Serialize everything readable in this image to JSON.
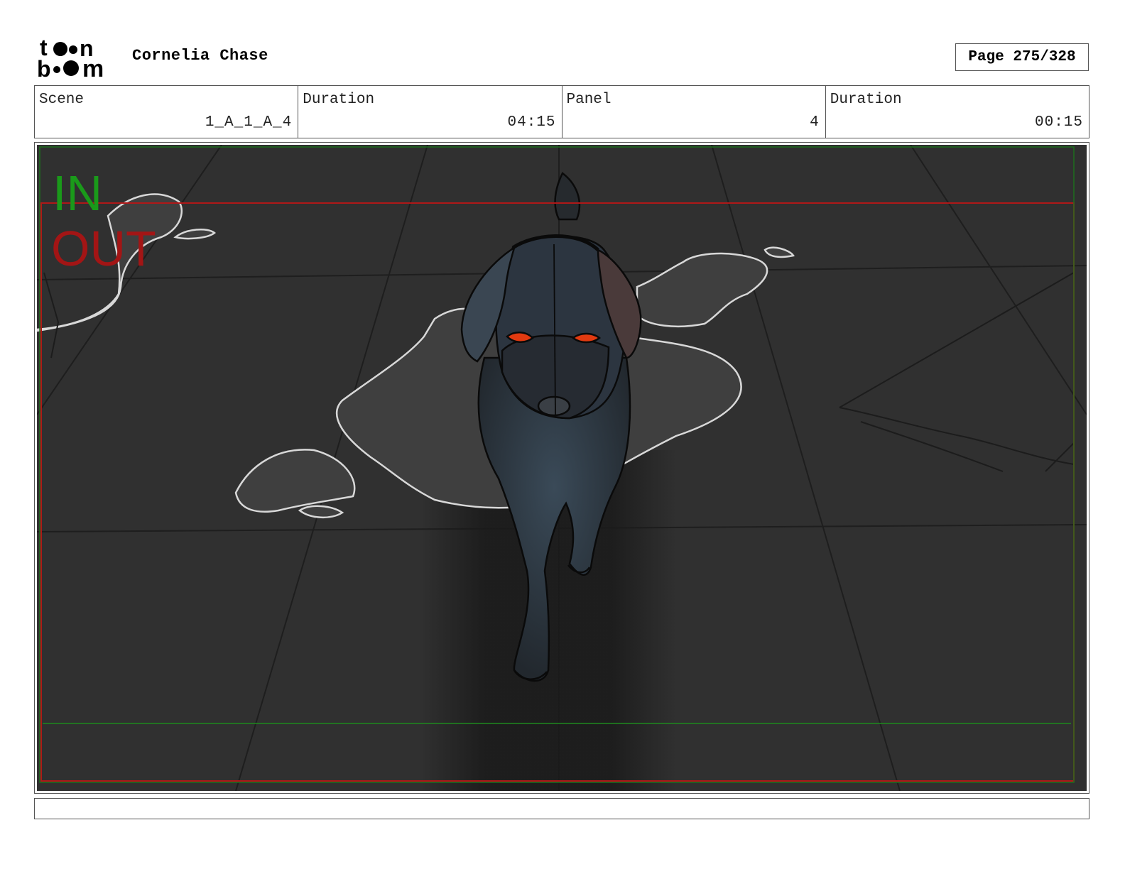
{
  "header": {
    "logo_text": "toon boom",
    "project_title": "Cornelia Chase",
    "page_label": "Page 275/328"
  },
  "info": {
    "scene_label": "Scene",
    "scene_value": "1_A_1_A_4",
    "scene_duration_label": "Duration",
    "scene_duration_value": "04:15",
    "panel_label": "Panel",
    "panel_value": "4",
    "panel_duration_label": "Duration",
    "panel_duration_value": "00:15"
  },
  "panel": {
    "in_label": "IN",
    "out_label": "OUT",
    "colors": {
      "background": "#2f2f2f",
      "in_marker": "#1a9a1a",
      "out_marker": "#a31515",
      "eyes": "#e23a10"
    }
  },
  "notes": {
    "text": ""
  }
}
